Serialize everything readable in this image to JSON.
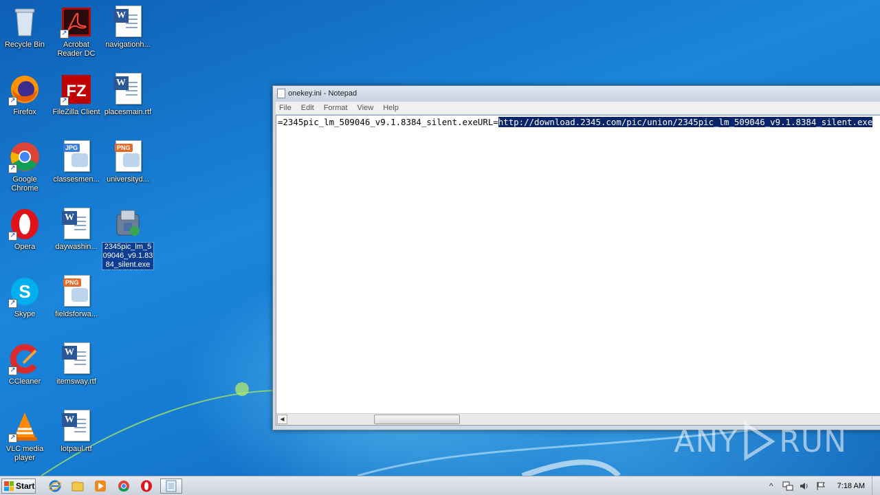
{
  "desktop": {
    "icons": [
      {
        "label": "Recycle Bin",
        "icon": "recycle-bin-icon"
      },
      {
        "label": "Acrobat Reader DC",
        "icon": "acrobat-reader-icon"
      },
      {
        "label": "navigationh...",
        "icon": "word-document-icon"
      },
      {
        "label": "Firefox",
        "icon": "firefox-icon"
      },
      {
        "label": "FileZilla Client",
        "icon": "filezilla-icon"
      },
      {
        "label": "placesmain.rtf",
        "icon": "word-document-icon"
      },
      {
        "label": "Google Chrome",
        "icon": "chrome-icon"
      },
      {
        "label": "classesmen...",
        "icon": "jpg-file-icon"
      },
      {
        "label": "universityd...",
        "icon": "png-file-icon"
      },
      {
        "label": "Opera",
        "icon": "opera-icon"
      },
      {
        "label": "daywashin...",
        "icon": "word-document-icon"
      },
      {
        "label": "2345pic_lm_509046_v9.1.8384_silent.exe",
        "icon": "installer-exe-icon"
      },
      {
        "label": "Skype",
        "icon": "skype-icon"
      },
      {
        "label": "fieldsforwa...",
        "icon": "png-file-icon"
      },
      {
        "label": "CCleaner",
        "icon": "ccleaner-icon"
      },
      {
        "label": "itemsway.rtf",
        "icon": "word-document-icon"
      },
      {
        "label": "VLC media player",
        "icon": "vlc-icon"
      },
      {
        "label": "lotpaul.rtf",
        "icon": "word-document-icon"
      }
    ],
    "badges": {
      "jpg": "JPG",
      "png": "PNG",
      "word": "W",
      "filezilla": "FZ",
      "skype": "S",
      "shortcut": "↗"
    }
  },
  "notepad": {
    "title": "onekey.ini - Notepad",
    "menu": [
      "File",
      "Edit",
      "Format",
      "View",
      "Help"
    ],
    "text_before": "=2345pic_lm_509046_v9.1.8384_silent.exeURL=",
    "text_selected": "http://download.2345.com/pic/union/2345pic_lm_509046_v9.1.8384_silent.exe",
    "scroll_left": "◀"
  },
  "watermark": {
    "left": "ANY",
    "right": "RUN"
  },
  "taskbar": {
    "start_label": "Start",
    "pinned": [
      "internet-explorer-icon",
      "file-explorer-icon",
      "media-player-icon",
      "chrome-icon",
      "opera-icon",
      "notepad-icon"
    ],
    "tray_expand": "^",
    "clock": "7:18 AM"
  },
  "colors": {
    "selection": "#0a246a",
    "desktop": "#1578cf"
  }
}
